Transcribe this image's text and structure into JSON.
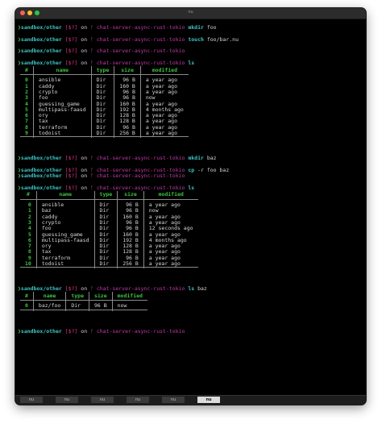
{
  "window": {
    "title": "nu"
  },
  "prompt": {
    "arrow": "❯",
    "dir": "sandbox/other",
    "git": "[$?]",
    "on": "on",
    "branch": "ᚠ chat-server-async-rust-tokio"
  },
  "commands": [
    {
      "cmd": "mkdir",
      "args": "foo"
    },
    {
      "cmd": "touch",
      "args": "foo/bar.nu"
    },
    {
      "cmd": "",
      "args": ""
    },
    {
      "cmd": "ls",
      "args": ""
    },
    {
      "cmd": "mkdir",
      "args": "baz"
    },
    {
      "cmd": "cp",
      "args": "-r foo baz"
    },
    {
      "cmd": "",
      "args": ""
    },
    {
      "cmd": "ls",
      "args": ""
    },
    {
      "cmd": "ls",
      "args": "baz"
    },
    {
      "cmd": "",
      "args": ""
    }
  ],
  "table1": {
    "headers": [
      "#",
      "name",
      "type",
      "size",
      "modified"
    ],
    "rows": [
      [
        "0",
        "ansible",
        "Dir",
        "96 B",
        "a year ago"
      ],
      [
        "1",
        "caddy",
        "Dir",
        "160 B",
        "a year ago"
      ],
      [
        "2",
        "crypto",
        "Dir",
        "96 B",
        "a year ago"
      ],
      [
        "3",
        "foo",
        "Dir",
        "96 B",
        "now"
      ],
      [
        "4",
        "guessing_game",
        "Dir",
        "160 B",
        "a year ago"
      ],
      [
        "5",
        "multipass-faasd",
        "Dir",
        "192 B",
        "4 months ago"
      ],
      [
        "6",
        "ory",
        "Dir",
        "128 B",
        "a year ago"
      ],
      [
        "7",
        "tax",
        "Dir",
        "128 B",
        "a year ago"
      ],
      [
        "8",
        "terraform",
        "Dir",
        "96 B",
        "a year ago"
      ],
      [
        "9",
        "todoist",
        "Dir",
        "256 B",
        "a year ago"
      ]
    ]
  },
  "table2": {
    "headers": [
      "#",
      "name",
      "type",
      "size",
      "modified"
    ],
    "rows": [
      [
        "0",
        "ansible",
        "Dir",
        "96 B",
        "a year ago"
      ],
      [
        "1",
        "baz",
        "Dir",
        "96 B",
        "now"
      ],
      [
        "2",
        "caddy",
        "Dir",
        "160 B",
        "a year ago"
      ],
      [
        "3",
        "crypto",
        "Dir",
        "96 B",
        "a year ago"
      ],
      [
        "4",
        "foo",
        "Dir",
        "96 B",
        "12 seconds ago"
      ],
      [
        "5",
        "guessing_game",
        "Dir",
        "160 B",
        "a year ago"
      ],
      [
        "6",
        "multipass-faasd",
        "Dir",
        "192 B",
        "4 months ago"
      ],
      [
        "7",
        "ory",
        "Dir",
        "128 B",
        "a year ago"
      ],
      [
        "8",
        "tax",
        "Dir",
        "128 B",
        "a year ago"
      ],
      [
        "9",
        "terraform",
        "Dir",
        "96 B",
        "a year ago"
      ],
      [
        "10",
        "todoist",
        "Dir",
        "256 B",
        "a year ago"
      ]
    ]
  },
  "table3": {
    "headers": [
      "#",
      "name",
      "type",
      "size",
      "modified"
    ],
    "rows": [
      [
        "0",
        "baz/foo",
        "Dir",
        "96 B",
        "now"
      ]
    ]
  },
  "tabs": [
    {
      "label": "nu",
      "active": false
    },
    {
      "label": "nu",
      "active": false
    },
    {
      "label": "nu",
      "active": false
    },
    {
      "label": "nu",
      "active": false
    },
    {
      "label": "nu",
      "active": false
    },
    {
      "label": "nu",
      "active": true
    }
  ],
  "colors": {
    "prompt_dir": "#3fc6c6",
    "git": "#e0337f",
    "branch": "#c23aa6",
    "header": "#3cc23c"
  }
}
